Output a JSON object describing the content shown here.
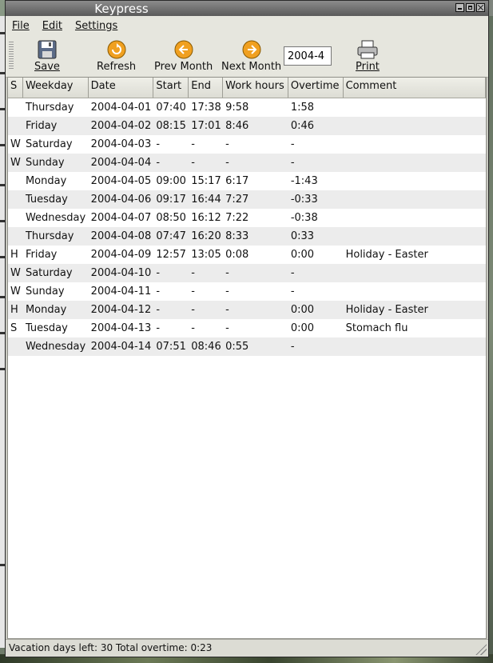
{
  "window": {
    "title": "Keypress"
  },
  "menu": [
    {
      "label": "File"
    },
    {
      "label": "Edit"
    },
    {
      "label": "Settings"
    }
  ],
  "toolbar": {
    "save_label": "Save",
    "refresh_label": "Refresh",
    "prev_month_label": "Prev Month",
    "next_month_label": "Next Month",
    "month_value": "2004-4",
    "print_label": "Print"
  },
  "table": {
    "columns": [
      "S",
      "Weekday",
      "Date",
      "Start",
      "End",
      "Work hours",
      "Overtime",
      "Comment"
    ],
    "rows": [
      [
        "",
        "Thursday",
        "2004-04-01",
        "07:40",
        "17:38",
        "9:58",
        "1:58",
        ""
      ],
      [
        "",
        "Friday",
        "2004-04-02",
        "08:15",
        "17:01",
        "8:46",
        "0:46",
        ""
      ],
      [
        "W",
        "Saturday",
        "2004-04-03",
        "-",
        "-",
        "-",
        "-",
        ""
      ],
      [
        "W",
        "Sunday",
        "2004-04-04",
        "-",
        "-",
        "-",
        "-",
        ""
      ],
      [
        "",
        "Monday",
        "2004-04-05",
        "09:00",
        "15:17",
        "6:17",
        "-1:43",
        ""
      ],
      [
        "",
        "Tuesday",
        "2004-04-06",
        "09:17",
        "16:44",
        "7:27",
        "-0:33",
        ""
      ],
      [
        "",
        "Wednesday",
        "2004-04-07",
        "08:50",
        "16:12",
        "7:22",
        "-0:38",
        ""
      ],
      [
        "",
        "Thursday",
        "2004-04-08",
        "07:47",
        "16:20",
        "8:33",
        "0:33",
        ""
      ],
      [
        "H",
        "Friday",
        "2004-04-09",
        "12:57",
        "13:05",
        "0:08",
        "0:00",
        "Holiday - Easter"
      ],
      [
        "W",
        "Saturday",
        "2004-04-10",
        "-",
        "-",
        "-",
        "-",
        ""
      ],
      [
        "W",
        "Sunday",
        "2004-04-11",
        "-",
        "-",
        "-",
        "-",
        ""
      ],
      [
        "H",
        "Monday",
        "2004-04-12",
        "-",
        "-",
        "-",
        "0:00",
        "Holiday - Easter"
      ],
      [
        "S",
        "Tuesday",
        "2004-04-13",
        "-",
        "-",
        "-",
        "0:00",
        "Stomach flu"
      ],
      [
        "",
        "Wednesday",
        "2004-04-14",
        "07:51",
        "08:46",
        "0:55",
        "-",
        ""
      ]
    ]
  },
  "status": {
    "text": "Vacation days left: 30  Total overtime: 0:23"
  },
  "colors": {
    "toolbar_bg": "#e6e6de",
    "icon_orange": "#f0a020",
    "row_alt": "#ececec"
  }
}
